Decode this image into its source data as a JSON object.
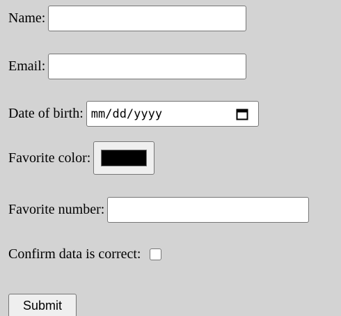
{
  "form": {
    "name_label": "Name:",
    "name_value": "",
    "email_label": "Email:",
    "email_value": "",
    "dob_label": "Date of birth:",
    "dob_placeholder": "mm/dd/yyyy",
    "color_label": "Favorite color:",
    "color_value": "#000000",
    "number_label": "Favorite number:",
    "number_value": "",
    "confirm_label": "Confirm data is correct:",
    "confirm_checked": false,
    "submit_label": "Submit"
  },
  "icons": {
    "date_picker": "calendar-icon"
  }
}
